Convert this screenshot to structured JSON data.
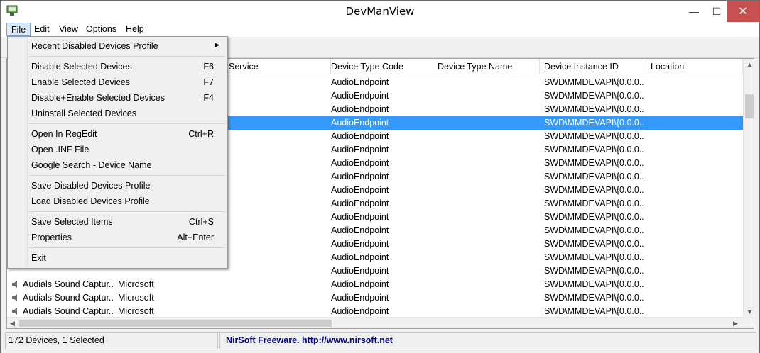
{
  "window": {
    "title": "DevManView",
    "minimize_glyph": "—",
    "maximize_glyph": "☐",
    "close_glyph": "✕",
    "close_color": "#c75050"
  },
  "menubar": {
    "items": [
      "File",
      "Edit",
      "View",
      "Options",
      "Help"
    ]
  },
  "file_menu": {
    "items": [
      {
        "label": "Recent Disabled Devices Profile",
        "accel": "",
        "submenu": true
      },
      {
        "label": "Disable Selected Devices",
        "accel": "F6"
      },
      {
        "label": "Enable Selected Devices",
        "accel": "F7"
      },
      {
        "label": "Disable+Enable Selected Devices",
        "accel": "F4"
      },
      {
        "label": "Uninstall Selected Devices",
        "accel": ""
      },
      {
        "label": "Open In RegEdit",
        "accel": "Ctrl+R"
      },
      {
        "label": "Open .INF File",
        "accel": ""
      },
      {
        "label": "Google Search - Device Name",
        "accel": ""
      },
      {
        "label": "Save Disabled Devices Profile",
        "accel": ""
      },
      {
        "label": "Load Disabled Devices Profile",
        "accel": ""
      },
      {
        "label": "Save Selected Items",
        "accel": "Ctrl+S"
      },
      {
        "label": "Properties",
        "accel": "Alt+Enter"
      },
      {
        "label": "Exit",
        "accel": ""
      }
    ],
    "submenu_glyph": "▶"
  },
  "table": {
    "columns": [
      "Service",
      "Device Type Code",
      "Device Type Name",
      "Device Instance ID",
      "Location"
    ],
    "rows": [
      {
        "name": "",
        "desc": "",
        "code": "AudioEndpoint",
        "instance": "SWD\\MMDEVAPI\\{0.0.0...."
      },
      {
        "name": "",
        "desc": "",
        "code": "AudioEndpoint",
        "instance": "SWD\\MMDEVAPI\\{0.0.0...."
      },
      {
        "name": "",
        "desc": "",
        "code": "AudioEndpoint",
        "instance": "SWD\\MMDEVAPI\\{0.0.0...."
      },
      {
        "name": "",
        "desc": "",
        "code": "AudioEndpoint",
        "instance": "SWD\\MMDEVAPI\\{0.0.0...."
      },
      {
        "name": "",
        "desc": "",
        "code": "AudioEndpoint",
        "instance": "SWD\\MMDEVAPI\\{0.0.0...."
      },
      {
        "name": "",
        "desc": "",
        "code": "AudioEndpoint",
        "instance": "SWD\\MMDEVAPI\\{0.0.0...."
      },
      {
        "name": "",
        "desc": "",
        "code": "AudioEndpoint",
        "instance": "SWD\\MMDEVAPI\\{0.0.0...."
      },
      {
        "name": "",
        "desc": "",
        "code": "AudioEndpoint",
        "instance": "SWD\\MMDEVAPI\\{0.0.0...."
      },
      {
        "name": "",
        "desc": "",
        "code": "AudioEndpoint",
        "instance": "SWD\\MMDEVAPI\\{0.0.0...."
      },
      {
        "name": "",
        "desc": "",
        "code": "AudioEndpoint",
        "instance": "SWD\\MMDEVAPI\\{0.0.0...."
      },
      {
        "name": "",
        "desc": "",
        "code": "AudioEndpoint",
        "instance": "SWD\\MMDEVAPI\\{0.0.0...."
      },
      {
        "name": "",
        "desc": "",
        "code": "AudioEndpoint",
        "instance": "SWD\\MMDEVAPI\\{0.0.0...."
      },
      {
        "name": "",
        "desc": "",
        "code": "AudioEndpoint",
        "instance": "SWD\\MMDEVAPI\\{0.0.0...."
      },
      {
        "name": "",
        "desc": "",
        "code": "AudioEndpoint",
        "instance": "SWD\\MMDEVAPI\\{0.0.0...."
      },
      {
        "name": "",
        "desc": "",
        "code": "AudioEndpoint",
        "instance": "SWD\\MMDEVAPI\\{0.0.0...."
      },
      {
        "name": "Audials Sound Captur...",
        "desc": "Microsoft",
        "code": "AudioEndpoint",
        "instance": "SWD\\MMDEVAPI\\{0.0.0...."
      },
      {
        "name": "Audials Sound Captur...",
        "desc": "Microsoft",
        "code": "AudioEndpoint",
        "instance": "SWD\\MMDEVAPI\\{0.0.0...."
      },
      {
        "name": "Audials Sound Captur...",
        "desc": "Microsoft",
        "code": "AudioEndpoint",
        "instance": "SWD\\MMDEVAPI\\{0.0.0...."
      },
      {
        "name": "Audials Sound Captur...",
        "desc": "Microsoft",
        "code": "AudioEndpoint",
        "instance": "SWD\\MMDEVAPI\\{0.0.0...."
      }
    ],
    "selected_index": 3,
    "selection_color": "#3399ff",
    "row_icon": "speaker-icon"
  },
  "statusbar": {
    "count": "172 Devices, 1 Selected",
    "credit": "NirSoft Freeware.  http://www.nirsoft.net",
    "credit_color": "#00008b"
  }
}
